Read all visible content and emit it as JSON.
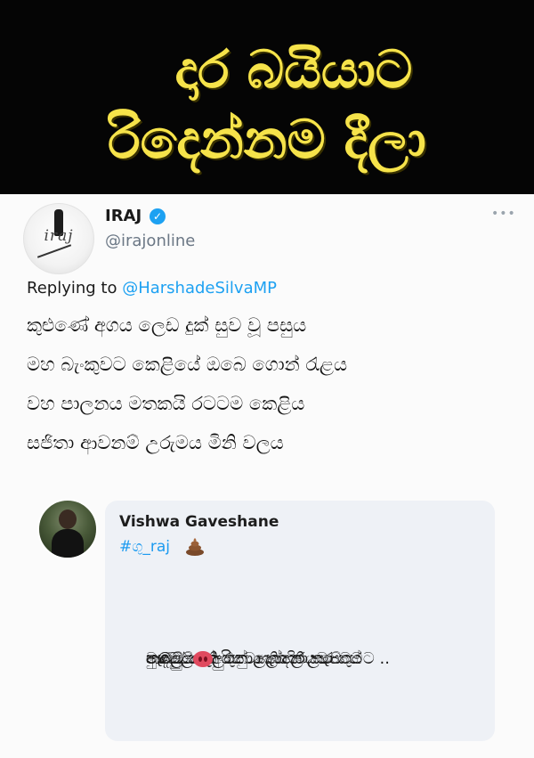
{
  "banner": {
    "line1": "දාර බයියාට",
    "line2": "රිදෙන්නම දීලා"
  },
  "tweet": {
    "author_name": "IRAJ",
    "author_handle": "@irajonline",
    "avatar_text": "iraj",
    "reply_prefix": "Replying to ",
    "reply_to": "@HarshadeSilvaMP",
    "lines": [
      "කුළුණේ අගය ලෙඩ දුක් සුව වූ පසුය",
      "මහ බැංකුවට කෙළියේ ඔබෙ ගොන් රැළය",
      "වහ පාලනය මතකයි රටටම කෙළිය",
      "සජිතා ආවනම් උරුමය මිනි වලය"
    ]
  },
  "reply": {
    "name": "Vishwa Gaveshane",
    "tag": "#ගු_raj",
    "lines": [
      "ආවේ නැති එකා ගැන කියවා කුමට ..",
      "ආව එකා අරිනවා තියලා සැපට..",
      "මැදමුලනේ කුනු හෝදන උබේ",
      "පු©ට..",
      "නෙලුම් කුලුනේ උල හිර කර ගන්",
      "තදට.."
    ]
  },
  "colors": {
    "banner_bg": "#050505",
    "banner_text": "#f6e34a",
    "link_blue": "#1da1f2",
    "muted_gray": "#6b7785",
    "reply_card_bg": "#eef1f6"
  },
  "icons": [
    "verified-icon",
    "more-icon",
    "poop-icon",
    "pig-icon"
  ]
}
